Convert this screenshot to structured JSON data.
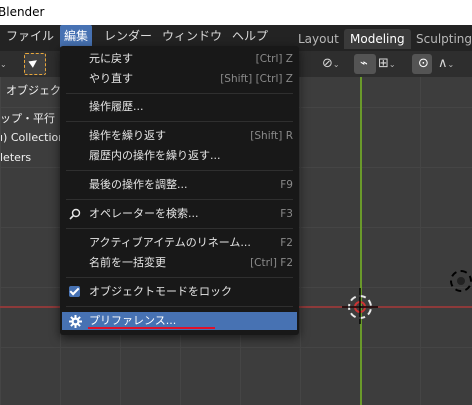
{
  "window": {
    "title": "Blender"
  },
  "menubar": {
    "items": [
      "ファイル",
      "編集",
      "レンダー",
      "ウィンドウ",
      "ヘルプ"
    ],
    "workspaces": [
      "Layout",
      "Modeling",
      "Sculpting"
    ]
  },
  "viewport": {
    "mode_label": "オブジェク",
    "overlay_lines": [
      "ップ・平行",
      "ı) Collection",
      "leters"
    ],
    "colors": {
      "x_axis": "#8d3a3a",
      "y_axis": "#6a9a2a"
    }
  },
  "edit_menu": {
    "items": [
      {
        "label": "元に戻す",
        "shortcut": "[Ctrl] Z"
      },
      {
        "label": "やり直す",
        "shortcut": "[Shift] [Ctrl] Z"
      },
      {
        "label": "操作履歴...",
        "shortcut": ""
      },
      {
        "label": "操作を繰り返す",
        "shortcut": "[Shift] R"
      },
      {
        "label": "履歴内の操作を繰り返す...",
        "shortcut": ""
      },
      {
        "label": "最後の操作を調整...",
        "shortcut": "F9"
      },
      {
        "label": "オペレーターを検索...",
        "shortcut": "F3"
      },
      {
        "label": "アクティブアイテムのリネーム...",
        "shortcut": "F2"
      },
      {
        "label": "名前を一括変更",
        "shortcut": "[Ctrl] F2"
      },
      {
        "label": "オブジェクトモードをロック",
        "shortcut": ""
      },
      {
        "label": "プリファレンス...",
        "shortcut": ""
      }
    ],
    "icons": {
      "search": "search-icon",
      "lock": "checkbox-checked",
      "prefs": "gear-icon"
    },
    "highlight_color": "#4772b3",
    "annotation_color": "#e0112a"
  }
}
